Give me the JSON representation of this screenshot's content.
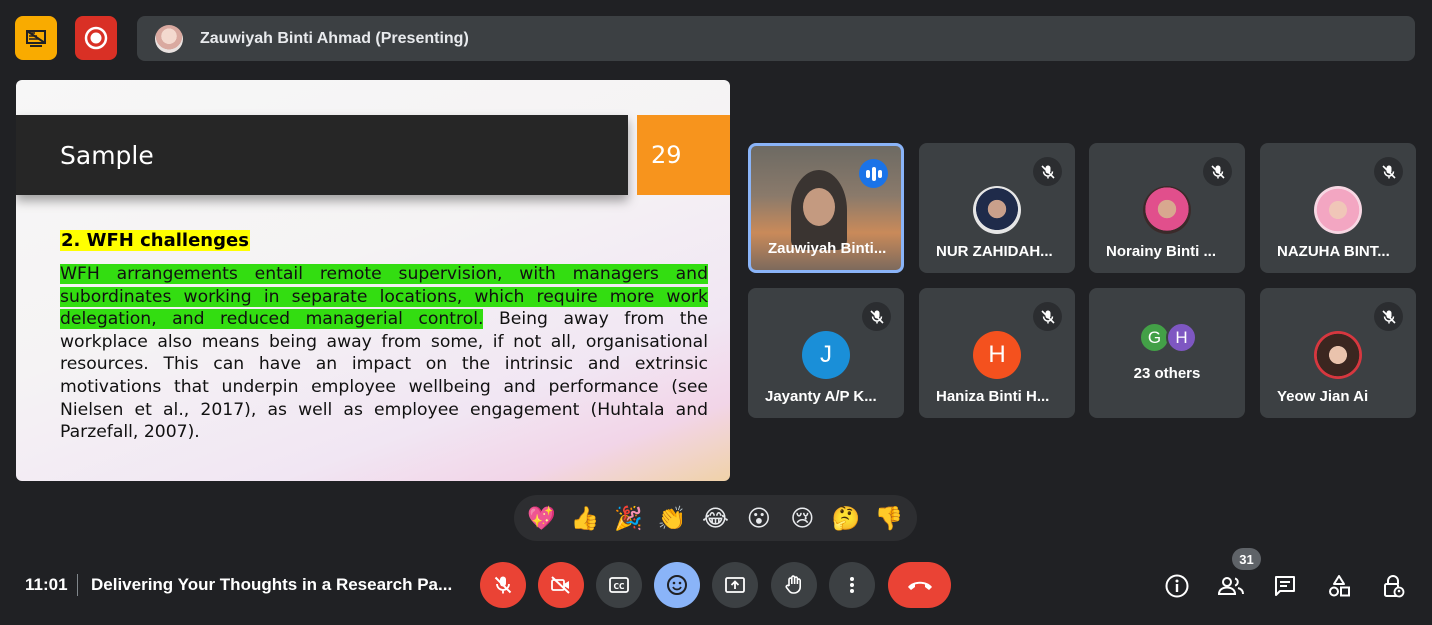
{
  "header": {
    "presenter_label": "Zauwiyah Binti Ahmad (Presenting)"
  },
  "slide": {
    "title": "Sample",
    "number": "29",
    "heading": "2. WFH challenges",
    "body_highlighted": "WFH arrangements entail remote supervision, with managers and subordinates working in separate locations, which require more work delegation, and reduced managerial control.",
    "body_rest": " Being away from the workplace also means being away from some, if not all, organisational resources. This can have an impact on the intrinsic and extrinsic motivations that underpin employee wellbeing and performance (see Nielsen et al., 2017), as well as employee engagement (Huhtala and Parzefall, 2007)."
  },
  "participants": [
    {
      "name": "Zauwiyah Binti...",
      "state": "speaking"
    },
    {
      "name": "NUR ZAHIDAH...",
      "state": "muted"
    },
    {
      "name": "Norainy Binti ...",
      "state": "muted"
    },
    {
      "name": "NAZUHA BINT...",
      "state": "muted"
    },
    {
      "name": "Jayanty A/P K...",
      "initial": "J",
      "state": "muted",
      "color": "#1a8fd8"
    },
    {
      "name": "Haniza Binti H...",
      "initial": "H",
      "state": "muted",
      "color": "#f4511e"
    },
    {
      "others_label": "23 others",
      "initials": [
        "G",
        "H"
      ],
      "colors": [
        "#43a047",
        "#7e57c2"
      ]
    },
    {
      "name": "Yeow Jian Ai",
      "state": "muted"
    }
  ],
  "reactions": [
    "💖",
    "👍",
    "🎉",
    "👏",
    "😂",
    "😮",
    "😢",
    "🤔",
    "👎"
  ],
  "footer": {
    "time": "11:01",
    "meeting_title": "Delivering Your Thoughts in a Research Pa...",
    "participant_count": "31"
  },
  "colors": {
    "background": "#202124",
    "tile": "#3c4043",
    "danger": "#ea4335",
    "accent": "#8ab4f8",
    "slide_highlight": "#33dd11",
    "slide_number_bg": "#f7941d"
  }
}
